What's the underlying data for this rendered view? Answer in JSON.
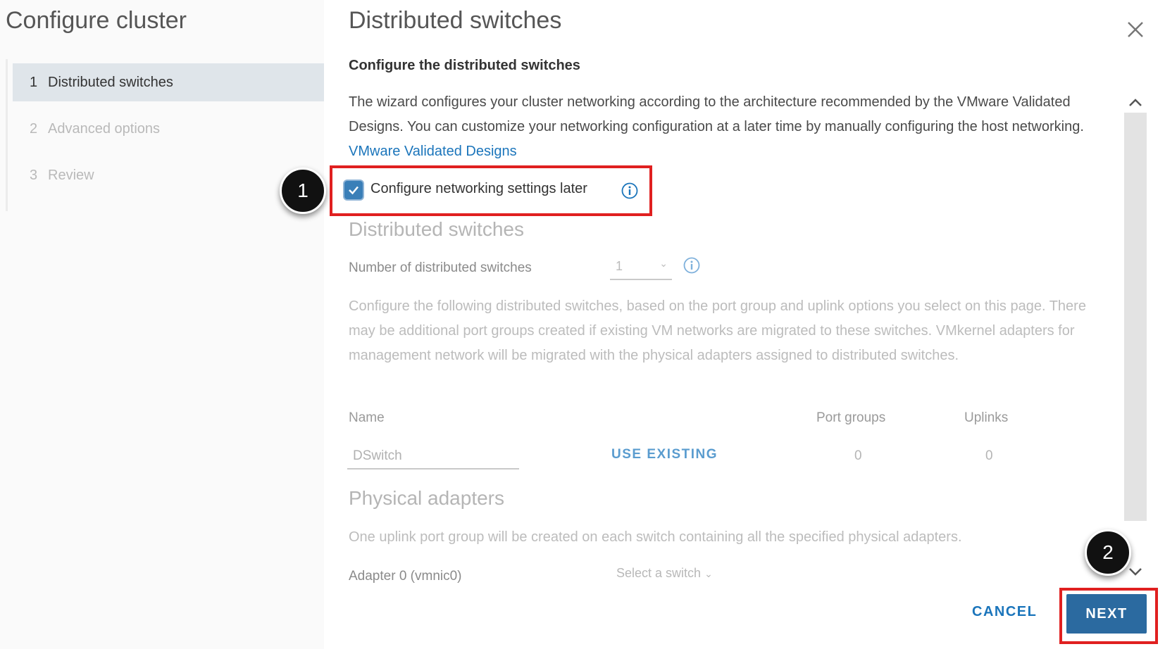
{
  "sidebar": {
    "title": "Configure cluster",
    "steps": [
      {
        "num": "1",
        "label": "Distributed switches"
      },
      {
        "num": "2",
        "label": "Advanced options"
      },
      {
        "num": "3",
        "label": "Review"
      }
    ]
  },
  "main": {
    "title": "Distributed switches",
    "subtitle": "Configure the distributed switches",
    "intro_text": "The wizard configures your cluster networking according to the architecture recommended by the VMware Validated Designs. You can customize your networking configuration at a later time by manually configuring the host networking. ",
    "intro_link": "VMware Validated Designs",
    "checkbox_label": "Configure networking settings later",
    "checkbox_checked": true,
    "callout_1": "1",
    "callout_2": "2",
    "section_switches": "Distributed switches",
    "num_switches_label": "Number of distributed switches",
    "num_switches_value": "1",
    "switches_description": "Configure the following distributed switches, based on the port group and uplink options you select on this page. There may be additional port groups created if existing VM networks are migrated to these switches. VMkernel adapters for management network will be migrated with the physical adapters assigned to distributed switches.",
    "table": {
      "headers": {
        "name": "Name",
        "port_groups": "Port groups",
        "uplinks": "Uplinks"
      },
      "row": {
        "name_value": "DSwitch",
        "action": "USE EXISTING",
        "port_groups": "0",
        "uplinks": "0"
      }
    },
    "section_adapters": "Physical adapters",
    "adapters_description": "One uplink port group will be created on each switch containing all the specified physical adapters.",
    "adapter_label": "Adapter 0 (vmnic0)",
    "adapter_select_placeholder": "Select a switch"
  },
  "footer": {
    "cancel_label": "CANCEL",
    "next_label": "NEXT"
  },
  "colors": {
    "accent": "#1b75bb",
    "primary_button": "#2b6aa0",
    "highlight_box": "#e02020"
  }
}
